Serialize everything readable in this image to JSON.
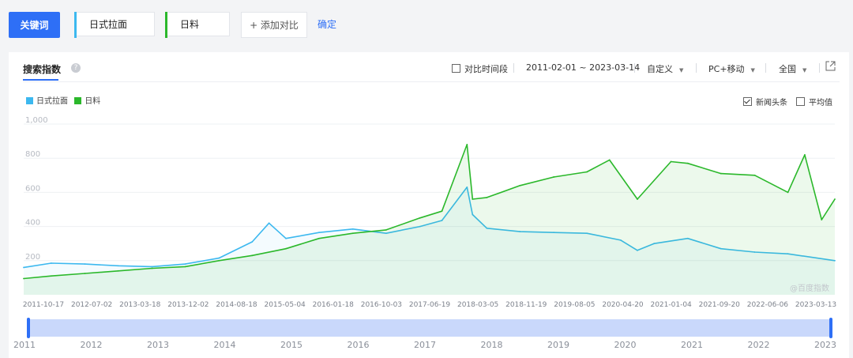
{
  "topbar": {
    "keyword_label": "关键词",
    "keywords": [
      {
        "text": "日式拉面",
        "color": "#3cb8ef"
      },
      {
        "text": "日料",
        "color": "#2bb82b"
      }
    ],
    "add_label": "+ 添加对比",
    "confirm_label": "确定"
  },
  "panel": {
    "title": "搜索指数",
    "help_icon": "question-circle-icon",
    "compare_label": "对比时间段",
    "date_range": "2011-02-01 ~ 2023-03-14",
    "custom_label": "自定义",
    "device_label": "PC+移动",
    "region_label": "全国",
    "share_icon": "external-link-icon",
    "news_label": "新闻头条",
    "news_checked": true,
    "avg_label": "平均值",
    "avg_checked": false,
    "watermark": "@百度指数"
  },
  "chart_data": {
    "type": "line",
    "ylim": [
      0,
      1000
    ],
    "yticks": [
      "1,000",
      "800",
      "600",
      "400",
      "200"
    ],
    "xticks": [
      "2011-10-17",
      "2012-07-02",
      "2013-03-18",
      "2013-12-02",
      "2014-08-18",
      "2015-05-04",
      "2016-01-18",
      "2016-10-03",
      "2017-06-19",
      "2018-03-05",
      "2018-11-19",
      "2019-08-05",
      "2020-04-20",
      "2021-01-04",
      "2021-09-20",
      "2022-06-06",
      "2023-03-13"
    ],
    "grid": true,
    "legend_placement": "top-left",
    "x_date_range": [
      "2011-02-01",
      "2023-03-14"
    ],
    "series": [
      {
        "name": "日式拉面",
        "color": "#3cb8ef",
        "x": [
          "2011-02-01",
          "2011-07-01",
          "2012-01-01",
          "2012-07-01",
          "2013-01-01",
          "2013-07-01",
          "2014-01-01",
          "2014-07-01",
          "2014-10-01",
          "2015-01-01",
          "2015-07-01",
          "2016-01-01",
          "2016-07-01",
          "2017-01-01",
          "2017-05-01",
          "2017-09-15",
          "2017-10-15",
          "2018-01-01",
          "2018-07-01",
          "2019-01-01",
          "2019-07-01",
          "2020-01-01",
          "2020-04-01",
          "2020-07-01",
          "2021-01-01",
          "2021-07-01",
          "2022-01-01",
          "2022-07-01",
          "2023-03-14"
        ],
        "values": [
          160,
          185,
          180,
          170,
          165,
          180,
          215,
          310,
          420,
          330,
          365,
          385,
          360,
          400,
          435,
          630,
          470,
          390,
          370,
          365,
          360,
          320,
          260,
          300,
          330,
          270,
          250,
          240,
          200
        ]
      },
      {
        "name": "日料",
        "color": "#2bb82b",
        "x": [
          "2011-02-01",
          "2011-07-01",
          "2012-01-01",
          "2012-07-01",
          "2013-01-01",
          "2013-07-01",
          "2014-01-01",
          "2014-07-01",
          "2015-01-01",
          "2015-07-01",
          "2016-01-01",
          "2016-07-01",
          "2017-01-01",
          "2017-05-01",
          "2017-09-15",
          "2017-10-15",
          "2018-01-01",
          "2018-07-01",
          "2019-01-01",
          "2019-07-01",
          "2019-11-01",
          "2020-04-01",
          "2020-10-01",
          "2021-01-01",
          "2021-07-01",
          "2022-01-01",
          "2022-07-01",
          "2022-10-01",
          "2023-01-01",
          "2023-03-14"
        ],
        "values": [
          95,
          110,
          125,
          140,
          155,
          165,
          200,
          230,
          270,
          330,
          360,
          380,
          450,
          490,
          880,
          560,
          570,
          640,
          690,
          720,
          790,
          560,
          780,
          770,
          710,
          700,
          600,
          820,
          440,
          560
        ]
      }
    ]
  },
  "slider": {
    "years": [
      "2011",
      "2012",
      "2013",
      "2014",
      "2015",
      "2016",
      "2017",
      "2018",
      "2019",
      "2020",
      "2021",
      "2022",
      "2023"
    ]
  }
}
